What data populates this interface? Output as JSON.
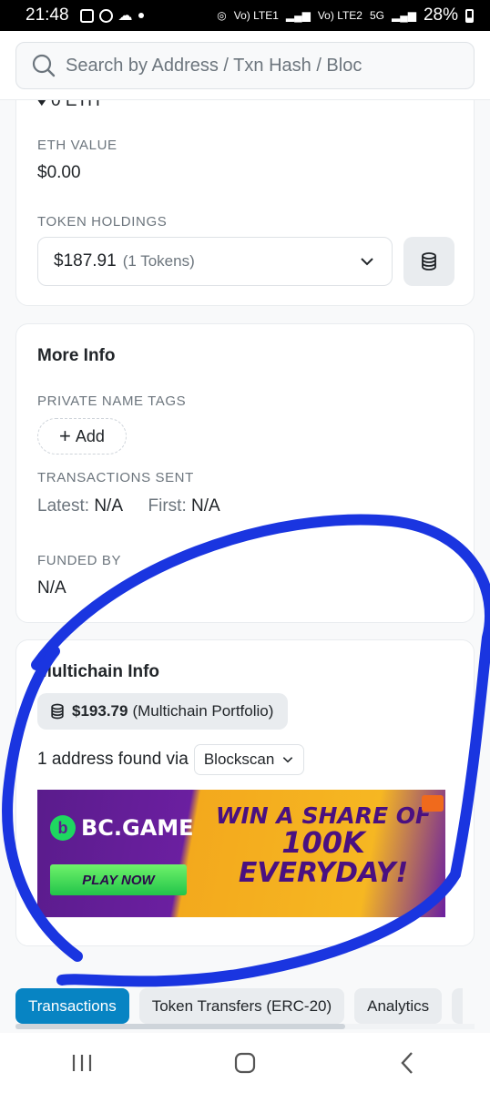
{
  "status_bar": {
    "time": "21:48",
    "network_1": "Vo) LTE1",
    "network_2": "Vo) LTE2",
    "network_type": "5G",
    "battery": "28%"
  },
  "search": {
    "placeholder": "Search by Address / Txn Hash / Bloc"
  },
  "overview_card": {
    "partial_text": "♦ 0 ETH",
    "eth_value_label": "ETH VALUE",
    "eth_value": "$0.00",
    "token_holdings_label": "TOKEN HOLDINGS",
    "token_holdings_value": "$187.91",
    "token_holdings_count": "(1 Tokens)"
  },
  "more_info": {
    "title": "More Info",
    "private_tags_label": "PRIVATE NAME TAGS",
    "add_label": "Add",
    "tx_sent_label": "TRANSACTIONS SENT",
    "latest_label": "Latest:",
    "latest_value": "N/A",
    "first_label": "First:",
    "first_value": "N/A",
    "funded_by_label": "FUNDED BY",
    "funded_by_value": "N/A"
  },
  "multichain": {
    "title": "Multichain Info",
    "portfolio_amount": "$193.79",
    "portfolio_label": "(Multichain Portfolio)",
    "found_text": "1 address found via",
    "blockscan_label": "Blockscan"
  },
  "ad": {
    "brand": "BC.GAME",
    "cta": "PLAY NOW",
    "headline_1": "WIN A SHARE OF",
    "headline_2": "100K",
    "headline_3": "EVERYDAY!"
  },
  "tabs": [
    {
      "label": "Transactions",
      "active": true
    },
    {
      "label": "Token Transfers (ERC-20)",
      "active": false
    },
    {
      "label": "Analytics",
      "active": false
    }
  ],
  "colors": {
    "accent": "#0784c3",
    "annotation_stroke": "#1a35e0"
  }
}
